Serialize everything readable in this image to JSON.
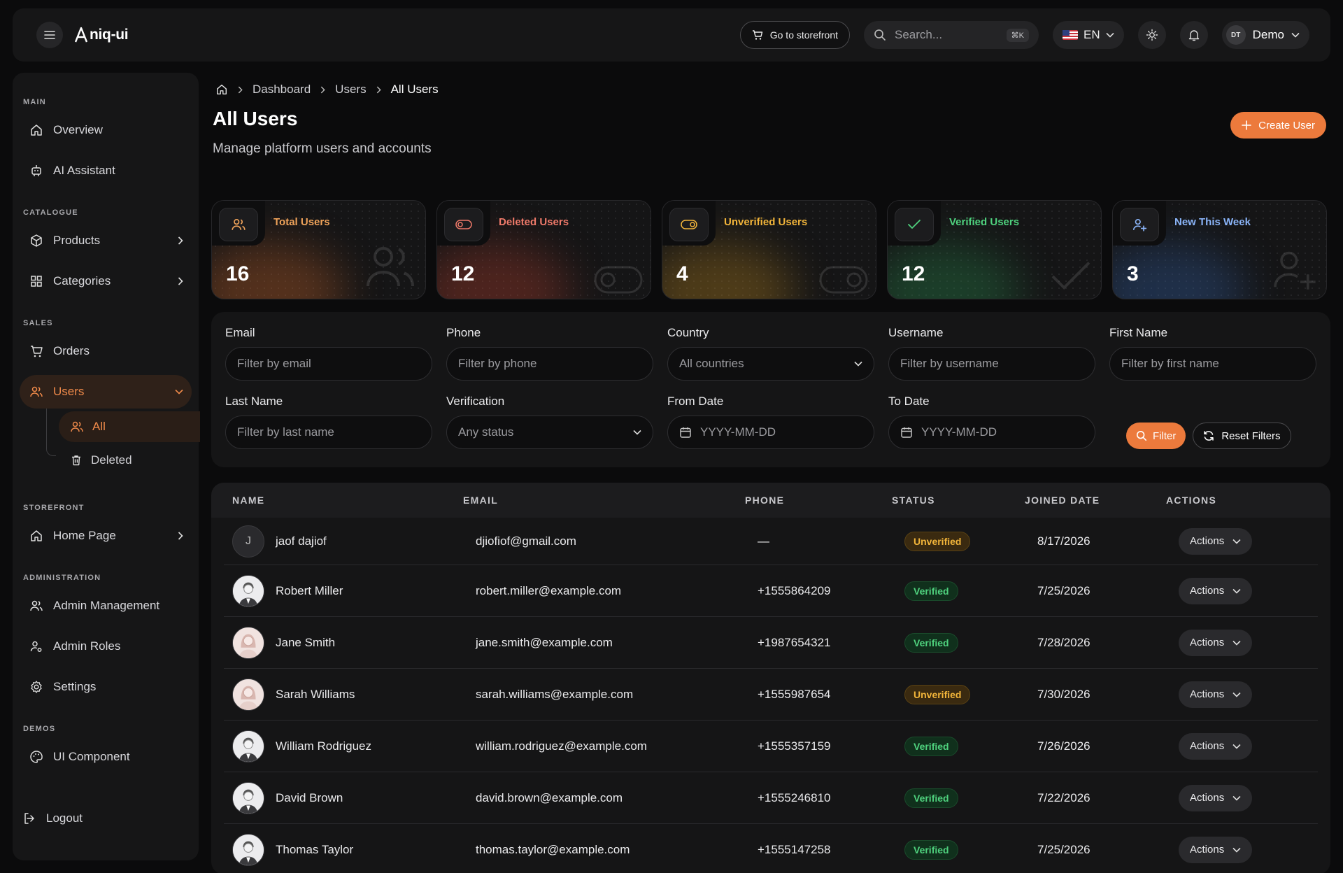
{
  "topbar": {
    "logo": "niq-ui",
    "storefront_label": "Go to storefront",
    "search_placeholder": "Search...",
    "search_shortcut": "⌘K",
    "language": "EN",
    "user_initials": "DT",
    "user_name": "Demo"
  },
  "sidebar": {
    "sections": {
      "main": "MAIN",
      "catalogue": "CATALOGUE",
      "sales": "SALES",
      "storefront": "STOREFRONT",
      "administration": "ADMINISTRATION",
      "demos": "DEMOS"
    },
    "items": {
      "overview": "Overview",
      "ai_assistant": "AI Assistant",
      "products": "Products",
      "categories": "Categories",
      "orders": "Orders",
      "users": "Users",
      "users_all": "All",
      "users_deleted": "Deleted",
      "home_page": "Home Page",
      "admin_management": "Admin Management",
      "admin_roles": "Admin Roles",
      "settings": "Settings",
      "ui_component": "UI Component",
      "logout": "Logout"
    }
  },
  "breadcrumb": [
    "Dashboard",
    "Users",
    "All Users"
  ],
  "page": {
    "title": "All Users",
    "subtitle": "Manage platform users and accounts",
    "create_label": "Create User"
  },
  "stats": [
    {
      "label": "Total Users",
      "value": "16",
      "color": "#f0a35a"
    },
    {
      "label": "Deleted Users",
      "value": "12",
      "color": "#f07a6a"
    },
    {
      "label": "Unverified Users",
      "value": "4",
      "color": "#f2b53a"
    },
    {
      "label": "Verified Users",
      "value": "12",
      "color": "#4fd27e"
    },
    {
      "label": "New This Week",
      "value": "3",
      "color": "#8ab4f8"
    }
  ],
  "filters": {
    "email": {
      "label": "Email",
      "placeholder": "Filter by email"
    },
    "phone": {
      "label": "Phone",
      "placeholder": "Filter by phone"
    },
    "country": {
      "label": "Country",
      "value": "All countries"
    },
    "username": {
      "label": "Username",
      "placeholder": "Filter by username"
    },
    "first_name": {
      "label": "First Name",
      "placeholder": "Filter by first name"
    },
    "last_name": {
      "label": "Last Name",
      "placeholder": "Filter by last name"
    },
    "verification": {
      "label": "Verification",
      "value": "Any status"
    },
    "from_date": {
      "label": "From Date",
      "placeholder": "YYYY-MM-DD"
    },
    "to_date": {
      "label": "To Date",
      "placeholder": "YYYY-MM-DD"
    },
    "filter_label": "Filter",
    "reset_label": "Reset Filters"
  },
  "table": {
    "headers": [
      "NAME",
      "EMAIL",
      "PHONE",
      "STATUS",
      "JOINED DATE",
      "ACTIONS"
    ],
    "action_label": "Actions",
    "rows": [
      {
        "initial": "J",
        "name": "jaof dajiof",
        "email": "djiofiof@gmail.com",
        "phone": "—",
        "status": "Unverified",
        "joined": "8/17/2026"
      },
      {
        "initial": "",
        "name": "Robert Miller",
        "email": "robert.miller@example.com",
        "phone": "+1555864209",
        "status": "Verified",
        "joined": "7/25/2026"
      },
      {
        "initial": "",
        "name": "Jane Smith",
        "email": "jane.smith@example.com",
        "phone": "+1987654321",
        "status": "Verified",
        "joined": "7/28/2026"
      },
      {
        "initial": "",
        "name": "Sarah Williams",
        "email": "sarah.williams@example.com",
        "phone": "+1555987654",
        "status": "Unverified",
        "joined": "7/30/2026"
      },
      {
        "initial": "",
        "name": "William Rodriguez",
        "email": "william.rodriguez@example.com",
        "phone": "+1555357159",
        "status": "Verified",
        "joined": "7/26/2026"
      },
      {
        "initial": "",
        "name": "David Brown",
        "email": "david.brown@example.com",
        "phone": "+1555246810",
        "status": "Verified",
        "joined": "7/22/2026"
      },
      {
        "initial": "",
        "name": "Thomas Taylor",
        "email": "thomas.taylor@example.com",
        "phone": "+1555147258",
        "status": "Verified",
        "joined": "7/25/2026"
      }
    ]
  }
}
